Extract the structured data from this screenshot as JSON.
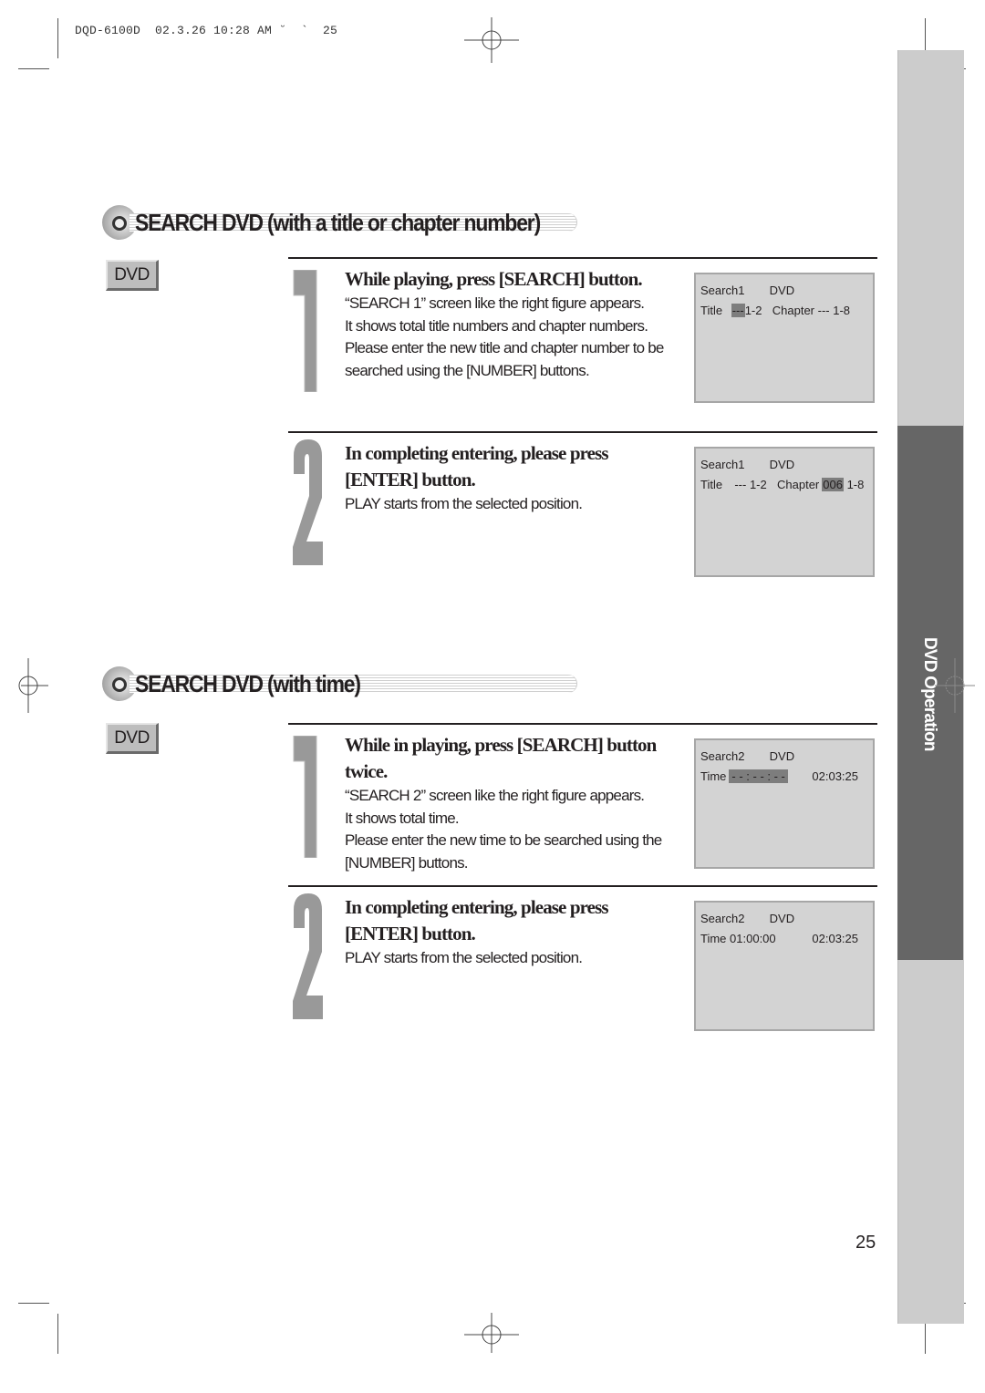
{
  "print_header": "DQD-6100D  02.3.26 10:28 AM ˘  `  25",
  "side_tab": {
    "label": "DVD Operation"
  },
  "page_number": "25",
  "sections": [
    {
      "title": "SEARCH DVD (with a title or chapter number)",
      "badge": "DVD",
      "steps": [
        {
          "number": "1",
          "heading": "While playing, press [SEARCH] button.",
          "body": [
            "“SEARCH 1” screen like the right figure appears.",
            "It shows total title numbers and chapter numbers.",
            "Please enter the new title and chapter number to be",
            "searched using the [NUMBER] buttons."
          ],
          "osd": {
            "mode": "Search1",
            "disc": "DVD",
            "title_label": "Title",
            "title_value": "---",
            "title_range": "1-2",
            "chapter_label": "Chapter",
            "chapter_value": "---",
            "chapter_range": "1-8",
            "highlighted": "title"
          }
        },
        {
          "number": "2",
          "heading_line1": "In completing entering, please press",
          "heading_line2": "[ENTER] button.",
          "body": [
            "PLAY starts from the selected position."
          ],
          "osd": {
            "mode": "Search1",
            "disc": "DVD",
            "title_label": "Title",
            "title_value": "---",
            "title_range": "1-2",
            "chapter_label": "Chapter",
            "chapter_value": "006",
            "chapter_range": "1-8",
            "highlighted": "chapter"
          }
        }
      ]
    },
    {
      "title": "SEARCH DVD (with time)",
      "badge": "DVD",
      "steps": [
        {
          "number": "1",
          "heading_line1": "While in playing, press [SEARCH] button",
          "heading_line2": "twice.",
          "body": [
            "“SEARCH 2” screen like the right figure appears.",
            "It shows total time.",
            "Please enter the new time to be searched using the",
            "[NUMBER] buttons."
          ],
          "osd": {
            "mode": "Search2",
            "disc": "DVD",
            "time_label": "Time",
            "time_value": "- - : - - : - -",
            "total_time": "02:03:25",
            "highlighted": "time"
          }
        },
        {
          "number": "2",
          "heading_line1": "In completing entering, please press",
          "heading_line2": "[ENTER] button.",
          "body": [
            "PLAY starts from the selected position."
          ],
          "osd": {
            "mode": "Search2",
            "disc": "DVD",
            "time_label": "Time",
            "time_value": "01:00:00",
            "total_time": "02:03:25",
            "highlighted": "none"
          }
        }
      ]
    }
  ],
  "colors": {
    "text": "#231f20",
    "side_strip": "#cccccc",
    "side_tab": "#666666",
    "osd_background": "#d3d3d3",
    "osd_highlight": "#7d7d7d",
    "step_number": "#999999"
  }
}
